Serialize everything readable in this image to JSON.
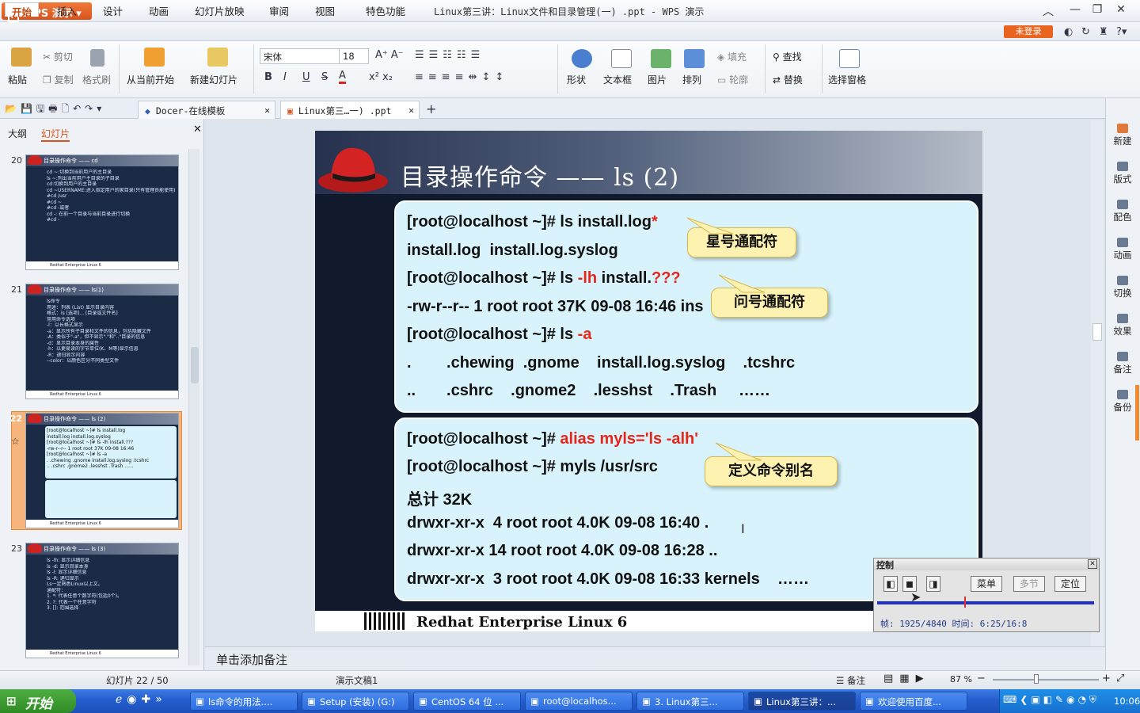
{
  "app": {
    "wps_label": "WPS 演示",
    "window_title": "Linux第三讲：Linux文件和目录管理(一) .ppt - WPS 演示",
    "login": "未登录"
  },
  "menu": [
    "开始",
    "插入",
    "设计",
    "动画",
    "幻灯片放映",
    "审阅",
    "视图",
    "特色功能"
  ],
  "ribbon": {
    "paste": "粘贴",
    "cut": "剪切",
    "copy": "复制",
    "format_painter": "格式刷",
    "from_current": "从当前开始",
    "new_slide": "新建幻灯片",
    "font_name": "宋体",
    "font_size": "18",
    "shape": "形状",
    "textbox": "文本框",
    "picture": "图片",
    "arrange": "排列",
    "fill": "填充",
    "outline": "轮廓",
    "find": "查找",
    "replace": "替换",
    "selection_pane": "选择窗格"
  },
  "tabs": [
    {
      "label": "Docer-在线模板"
    },
    {
      "label": "Linux第三…一) .ppt"
    }
  ],
  "left_panel": {
    "tab_outline": "大纲",
    "tab_slides": "幻灯片"
  },
  "thumbnails": [
    {
      "num": "20",
      "title": "目录操作命令 —— cd",
      "lines": [
        "cd ~:切换到当前用户的主目录",
        "ls ~:列出当前用户主目录的子目录",
        "cd:切换到用户的主目录",
        "cd ~USERNAME:进入指定用户的家目录(只有管理员能使用)",
        "#cd /usr",
        "#cd ~",
        "#cd -或者",
        "cd -: 在前一个目录与当前目录进行切换",
        "#cd -"
      ],
      "footer": "Redhat Enterprise Linux 6"
    },
    {
      "num": "21",
      "title": "目录操作命令 —— ls(1)",
      "lines": [
        "ls命令",
        "用途：列表 (List) 显示目录内容",
        "格式：ls [选项]... [目录或文件名]",
        "常用命令选项",
        "-l：以长格式显示",
        "-a：显示所有子目录和文件的信息，包括隐藏文件",
        "-A：类似于\"-a\"，但不显示\".\"和\"..\"目录的信息",
        "-d：显示目录本身的属性",
        "-h：以更易读的字节单位(K、M等)显示信息",
        "-R：递归显示内容",
        "--color：以颜色区分不同类型文件"
      ],
      "footer": "Redhat Enterprise Linux 6"
    },
    {
      "num": "22",
      "title": "目录操作命令 —— ls (2)",
      "lines": [
        "[root@localhost ~]# ls install.log",
        "install.log install.log.syslog",
        "[root@localhost ~]# ls -lh install.???",
        "-rw-r--r-- 1 root root 37K 09-08 16:46",
        "[root@localhost ~]# ls -a",
        ". .chewing .gnome install.log.syslog .tcshrc",
        ".. .cshrc .gnome2 .lesshst .Trash ......"
      ],
      "footer": "Redhat Enterprise Linux 6"
    },
    {
      "num": "23",
      "title": "目录操作命令 —— ls (3)",
      "lines": [
        "ls -lh: 显示详细信息",
        "ls -d: 显示目录本身",
        "ls -l: 显示详细信息",
        "ls -R: 递归显示",
        "Ls一定熟悉Linux以上文。",
        "通配符：",
        "1. *: 代表任意个数字符(包括0个)。",
        "2. ?: 代表一个任意字符",
        "3. []: 范围选择"
      ],
      "footer": "Redhat Enterprise Linux 6"
    }
  ],
  "slide": {
    "title": "目录操作命令 —— ls (2)",
    "panel1": [
      {
        "parts": [
          {
            "t": "[root@localhost ~]# ls install.log"
          },
          {
            "t": "*",
            "red": true
          }
        ]
      },
      {
        "parts": [
          {
            "t": "install.log  install.log.syslog"
          }
        ]
      },
      {
        "parts": [
          {
            "t": "[root@localhost ~]# ls "
          },
          {
            "t": "-lh",
            "red": true
          },
          {
            "t": " install."
          },
          {
            "t": "???",
            "red": true
          }
        ]
      },
      {
        "parts": [
          {
            "t": "-rw-r--r-- 1 root root 37K 09-08 16:46 ins"
          }
        ]
      },
      {
        "parts": [
          {
            "t": "[root@localhost ~]# ls "
          },
          {
            "t": "-a",
            "red": true
          }
        ]
      },
      {
        "parts": [
          {
            "t": ".        .chewing  .gnome    install.log.syslog    .tcshrc"
          }
        ]
      },
      {
        "parts": [
          {
            "t": "..       .cshrc    .gnome2    .lesshst    .Trash     ……"
          }
        ]
      }
    ],
    "panel2": [
      {
        "parts": [
          {
            "t": "[root@localhost ~]# "
          },
          {
            "t": "alias myls='ls -alh'",
            "red": true
          }
        ]
      },
      {
        "parts": [
          {
            "t": "[root@localhost ~]# myls /usr/src"
          }
        ]
      },
      {
        "parts": [
          {
            "t": "总计 32K"
          }
        ]
      },
      {
        "parts": [
          {
            "t": "drwxr-xr-x  4 root root 4.0K 09-08 16:40 ."
          }
        ]
      },
      {
        "parts": [
          {
            "t": "drwxr-xr-x 14 root root 4.0K 09-08 16:28 .."
          }
        ]
      },
      {
        "parts": [
          {
            "t": "drwxr-xr-x  3 root root 4.0K 09-08 16:33 kernels    ……"
          }
        ]
      }
    ],
    "callouts": [
      "星号通配符",
      "问号通配符",
      "定义命令别名"
    ],
    "footer": "Redhat Enterprise Linux 6"
  },
  "notes_placeholder": "单击添加备注",
  "right_bar": [
    "新建",
    "版式",
    "配色",
    "动画",
    "切换",
    "效果",
    "备注",
    "备份"
  ],
  "control": {
    "title": "控制",
    "menu": "菜单",
    "chapters": "多节",
    "locate": "定位",
    "frame_info": "帧: 1925/4840 时间: 6:25/16:8",
    "progress": 0.4
  },
  "status": {
    "slide_info": "幻灯片 22 / 50",
    "theme": "演示文稿1",
    "notes": "备注",
    "zoom": "87 %"
  },
  "taskbar": {
    "start": "开始",
    "tasks": [
      "ls命令的用法....",
      "Setup (安装) (G:)",
      "CentOS 64 位 ...",
      "root@localhos...",
      "3. Linux第三...",
      "Linux第三讲：...",
      "欢迎使用百度..."
    ],
    "active_index": 5,
    "clock": "10:06"
  },
  "colors": {
    "accent": "#e8641f",
    "slide_red": "#e6261a",
    "panel_bg": "#d8f3fb",
    "callout_bg": "#fef2b0"
  }
}
